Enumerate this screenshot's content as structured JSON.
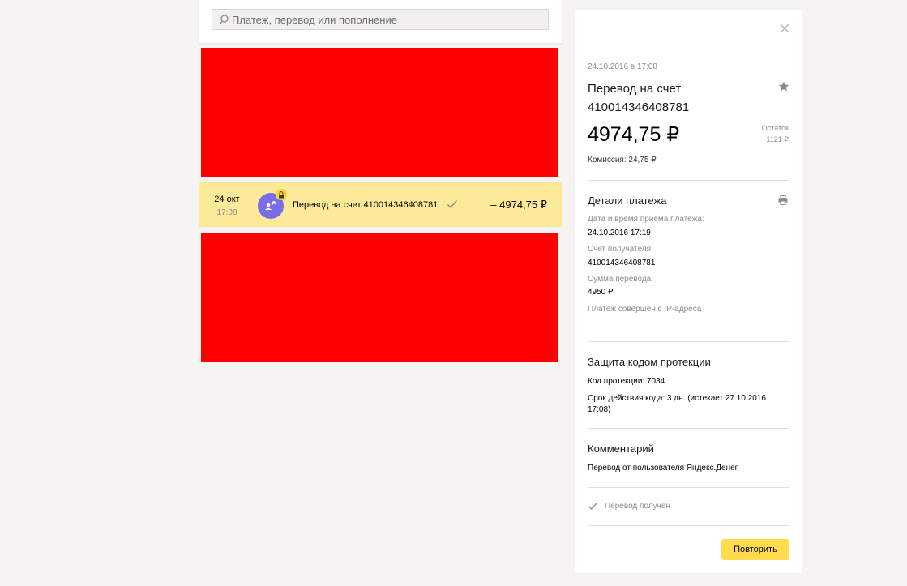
{
  "search": {
    "placeholder": "Платеж, перевод или пополнение"
  },
  "operation": {
    "day": "24 окт",
    "time": "17:08",
    "title": "Перевод на счет 410014346408781",
    "amount": "– 4974,75 ₽"
  },
  "details": {
    "datetime": "24.10.2016 в 17:08",
    "title": "Перевод на счет 410014346408781",
    "amount": "4974,75 ₽",
    "balance_label": "Остаток",
    "balance_value": "1121 ₽",
    "commission": "Комиссия: 24,75 ₽",
    "payment_section": {
      "title": "Детали платежа",
      "fields": [
        {
          "label": "Дата и время приема платежа:",
          "value": "24.10.2016 17:19"
        },
        {
          "label": "Счет получателя:",
          "value": "410014346408781"
        },
        {
          "label": "Сумма перевода:",
          "value": "4950 ₽"
        }
      ],
      "ip_note": "Платеж совершен с IP-адреса"
    },
    "protection_section": {
      "title": "Защита кодом протекции",
      "code": "Код протекции: 7034",
      "validity": "Срок действия кода: 3 дн. (истекает 27.10.2016 17:08)"
    },
    "comment_section": {
      "title": "Комментарий",
      "text": "Перевод от пользователя Яндекс.Денег"
    },
    "status": "Перевод получен",
    "repeat_label": "Повторить"
  },
  "colors": {
    "avatar": "#7a6ee6",
    "lock_badge": "#ffd230",
    "highlight_row": "#fdea99",
    "repeat_button": "#ffdb4d",
    "redacted": "#ff0000"
  },
  "icons": [
    "search-icon",
    "user-transfer-icon",
    "lock-icon",
    "check-icon",
    "close-icon",
    "star-icon",
    "print-icon"
  ]
}
